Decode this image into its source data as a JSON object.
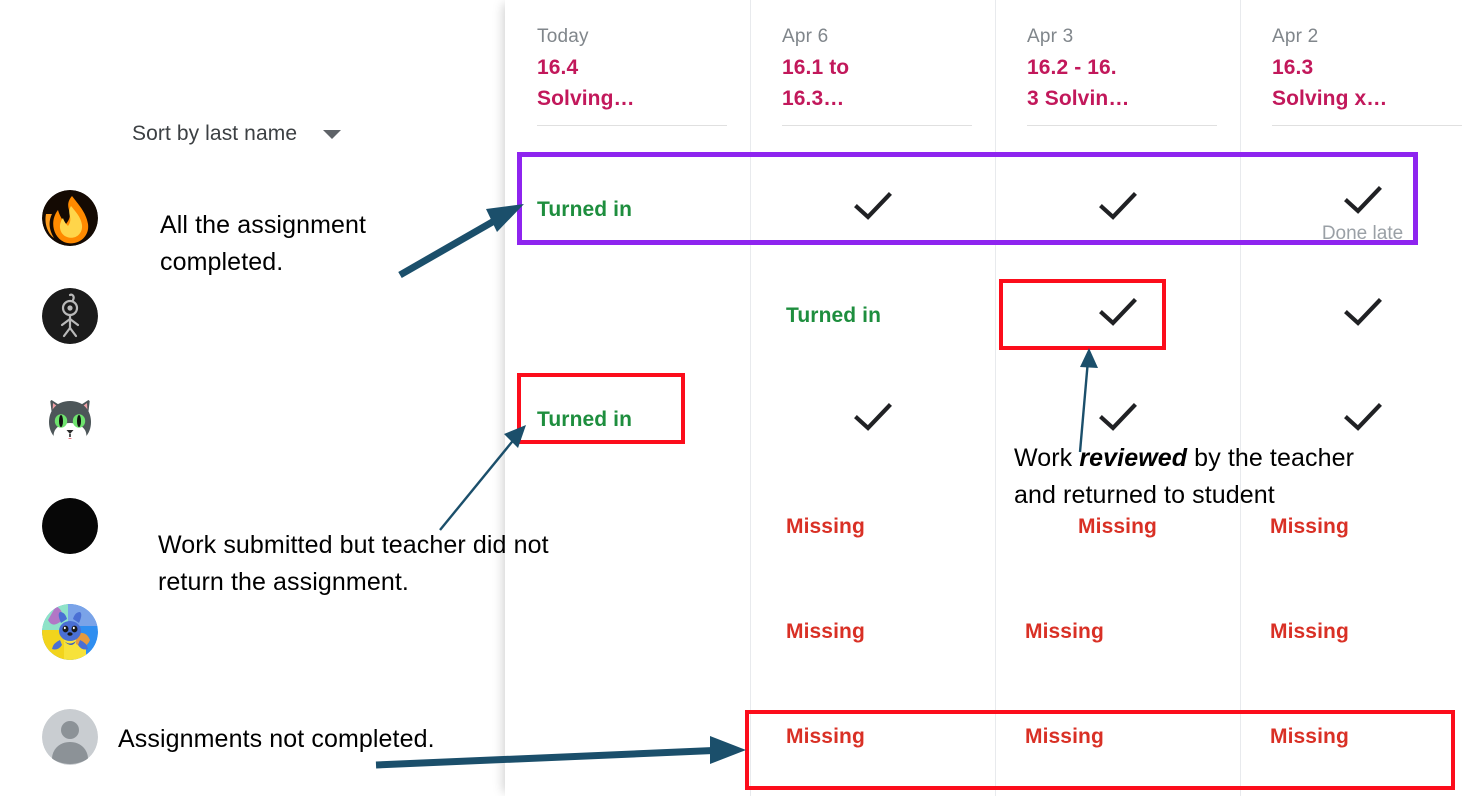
{
  "sort_control": {
    "label": "Sort by last name",
    "caret_icon": "chevron-down-icon"
  },
  "columns": [
    {
      "date": "Today",
      "title_line1": "16.4",
      "title_line2": "Solving…"
    },
    {
      "date": "Apr 6",
      "title_line1": "16.1 to",
      "title_line2": "16.3…"
    },
    {
      "date": "Apr 3",
      "title_line1": "16.2 - 16.",
      "title_line2": "3 Solvin…"
    },
    {
      "date": "Apr 2",
      "title_line1": "16.3",
      "title_line2": "Solving x…"
    }
  ],
  "rows": [
    {
      "avatar": "flame-avatar",
      "cells": [
        {
          "status": "Turned in",
          "type": "turned"
        },
        {
          "status": "",
          "type": "check"
        },
        {
          "status": "",
          "type": "check"
        },
        {
          "status": "",
          "type": "check",
          "sub": "Done late"
        }
      ]
    },
    {
      "avatar": "stick-figure-avatar",
      "cells": [
        {
          "status": "",
          "type": "empty"
        },
        {
          "status": "Turned in",
          "type": "turned"
        },
        {
          "status": "",
          "type": "check"
        },
        {
          "status": "",
          "type": "check"
        }
      ]
    },
    {
      "avatar": "cat-avatar",
      "cells": [
        {
          "status": "Turned in",
          "type": "turned"
        },
        {
          "status": "",
          "type": "check"
        },
        {
          "status": "",
          "type": "check"
        },
        {
          "status": "",
          "type": "check"
        }
      ]
    },
    {
      "avatar": "black-circle-avatar",
      "cells": [
        {
          "status": "",
          "type": "empty"
        },
        {
          "status": "Missing",
          "type": "missing"
        },
        {
          "status": "Missing",
          "type": "missing"
        },
        {
          "status": "Missing",
          "type": "missing"
        }
      ]
    },
    {
      "avatar": "stitch-avatar",
      "cells": [
        {
          "status": "",
          "type": "empty"
        },
        {
          "status": "Missing",
          "type": "missing"
        },
        {
          "status": "Missing",
          "type": "missing"
        },
        {
          "status": "Missing",
          "type": "missing"
        }
      ]
    },
    {
      "avatar": "default-person-avatar",
      "cells": [
        {
          "status": "",
          "type": "empty"
        },
        {
          "status": "Missing",
          "type": "missing"
        },
        {
          "status": "Missing",
          "type": "missing"
        },
        {
          "status": "Missing",
          "type": "missing"
        }
      ]
    }
  ],
  "annotations": {
    "completed": {
      "line1": "All the assignment",
      "line2": "completed."
    },
    "reviewed": {
      "pre": "Work ",
      "emphasis": "reviewed",
      "post": " by the teacher",
      "line2": "and returned to student"
    },
    "submitted": {
      "line1": "Work submitted but teacher did not",
      "line2": "return the assignment."
    },
    "notdone": {
      "line1": "Assignments not completed."
    }
  },
  "colors": {
    "purple_highlight": "#8e24ef",
    "red_highlight": "#fc0d1b",
    "turned_in_green": "#1e8e3e",
    "missing_red": "#d93025",
    "header_pink": "#c2185b",
    "arrow_navy": "#1b4f6b"
  }
}
